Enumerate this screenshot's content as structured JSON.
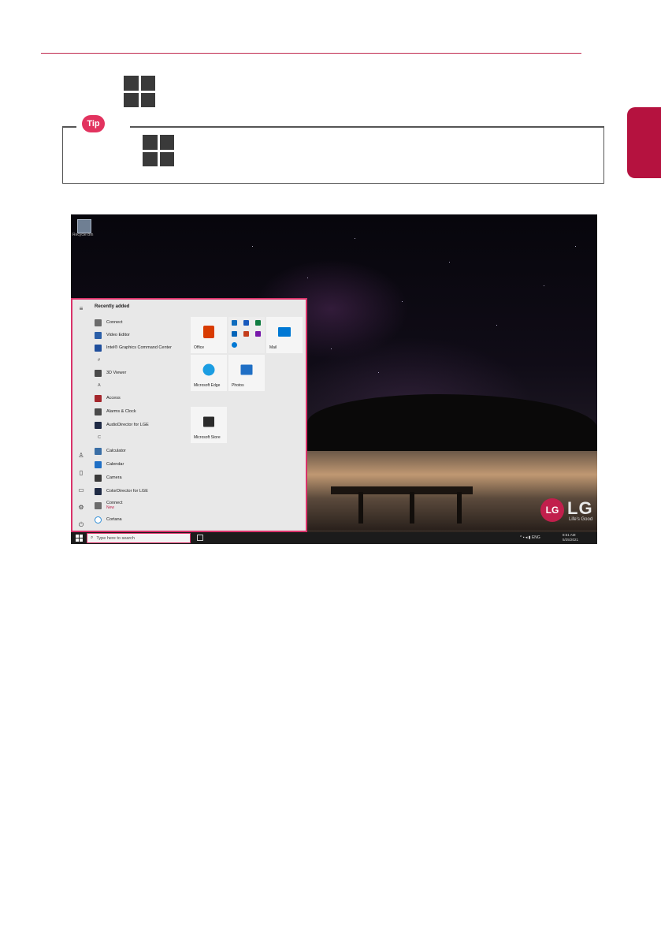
{
  "tip": {
    "badge": "Tip"
  },
  "desktop": {
    "recycle_bin_label": "Recycle Bin"
  },
  "start_menu": {
    "section_title": "Recently added",
    "apps": [
      {
        "label": "Connect",
        "color": "#6b6b6b"
      },
      {
        "label": "Video Editor",
        "color": "#2b5fa8"
      },
      {
        "label": "Intel® Graphics Command Center",
        "color": "#1f4e9c"
      },
      {
        "label": "3D Viewer",
        "color": "#4a4a4a"
      },
      {
        "label": "Access",
        "color": "#a4262c"
      },
      {
        "label": "Alarms & Clock",
        "color": "#4a4a4a"
      },
      {
        "label": "AudioDirector for LGE",
        "color": "#1f2a44"
      },
      {
        "label": "Calculator",
        "color": "#3a6ea5"
      },
      {
        "label": "Calendar",
        "color": "#1f6fc5"
      },
      {
        "label": "Camera",
        "color": "#3a3a3a"
      },
      {
        "label": "ColorDirector for LGE",
        "color": "#1f2a44"
      },
      {
        "label": "Connect",
        "color": "#6b6b6b",
        "sub": "New"
      },
      {
        "label": "Cortana",
        "color": "#2f8fd8"
      }
    ],
    "letters": [
      "#",
      "A",
      "C"
    ],
    "tiles": [
      {
        "label": "Office"
      },
      {
        "label": "Mail"
      },
      {
        "label": "Microsoft Edge"
      },
      {
        "label": "Photos"
      },
      {
        "label": "Microsoft Store"
      }
    ]
  },
  "taskbar": {
    "search_placeholder": "Type here to search",
    "tray_lang": "ENG",
    "clock_time": "8:51 AM",
    "clock_date": "5/25/2021"
  },
  "brand": {
    "logo": "LG",
    "slogan": "Life's Good",
    "accent": "#c11f4c"
  }
}
